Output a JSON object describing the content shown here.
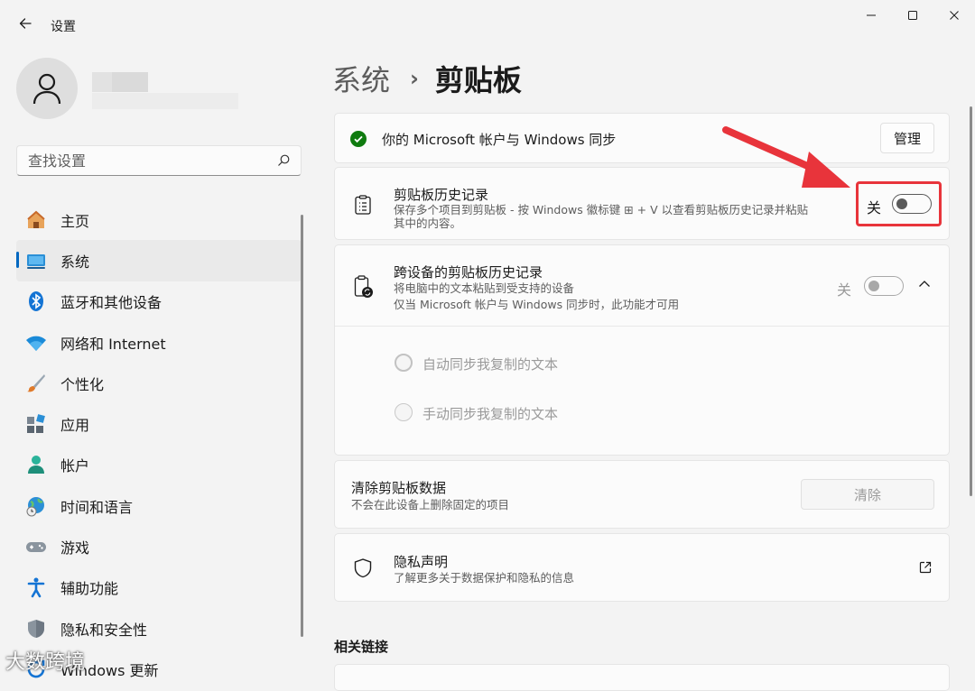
{
  "window": {
    "title": "设置"
  },
  "sidebar": {
    "search_placeholder": "查找设置",
    "items": [
      {
        "label": "主页",
        "icon": "home-icon"
      },
      {
        "label": "系统",
        "icon": "system-icon",
        "active": true
      },
      {
        "label": "蓝牙和其他设备",
        "icon": "bluetooth-icon"
      },
      {
        "label": "网络和 Internet",
        "icon": "wifi-icon"
      },
      {
        "label": "个性化",
        "icon": "brush-icon"
      },
      {
        "label": "应用",
        "icon": "apps-icon"
      },
      {
        "label": "帐户",
        "icon": "account-icon"
      },
      {
        "label": "时间和语言",
        "icon": "globe-clock-icon"
      },
      {
        "label": "游戏",
        "icon": "gamepad-icon"
      },
      {
        "label": "辅助功能",
        "icon": "accessibility-icon"
      },
      {
        "label": "隐私和安全性",
        "icon": "shield-icon"
      },
      {
        "label": "Windows 更新",
        "icon": "update-icon"
      }
    ],
    "watermark": "大数跨境"
  },
  "breadcrumb": {
    "parent": "系统",
    "separator": "›",
    "current": "剪贴板"
  },
  "sync_card": {
    "text": "你的 Microsoft 帐户与 Windows 同步",
    "button": "管理"
  },
  "history_card": {
    "title": "剪贴板历史记录",
    "desc_line1": "保存多个项目到剪贴板 - 按 Windows 徽标键 ⊞ + V 以查看剪贴板历史记录并粘贴",
    "desc_line2": "其中的内容。",
    "state_label": "关",
    "enabled": false
  },
  "cross_device_card": {
    "title": "跨设备的剪贴板历史记录",
    "desc_line1": "将电脑中的文本粘贴到受支持的设备",
    "desc_line2": "仅当 Microsoft 帐户与 Windows 同步时，此功能才可用",
    "state_label": "关",
    "enabled": false,
    "options": [
      "自动同步我复制的文本",
      "手动同步我复制的文本"
    ]
  },
  "clear_card": {
    "title": "清除剪贴板数据",
    "desc": "不会在此设备上删除固定的项目",
    "button": "清除"
  },
  "privacy_card": {
    "title": "隐私声明",
    "desc": "了解更多关于数据保护和隐私的信息"
  },
  "related": {
    "heading": "相关链接"
  },
  "colors": {
    "accent": "#0067c0",
    "highlight": "#e8343b",
    "success": "#0f7b0f"
  }
}
